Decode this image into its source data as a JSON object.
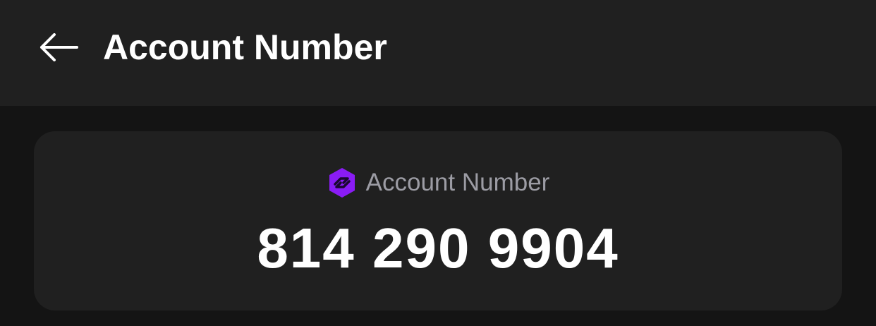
{
  "header": {
    "title": "Account Number",
    "back_icon": "arrow-left-icon"
  },
  "card": {
    "logo_icon": "brand-hexagon-logo",
    "label": "Account Number",
    "account_number": "814 290 9904"
  },
  "colors": {
    "background": "#141414",
    "surface": "#202020",
    "text_primary": "#ffffff",
    "text_secondary": "#9c9ca4",
    "brand": "#8a1cf5"
  }
}
